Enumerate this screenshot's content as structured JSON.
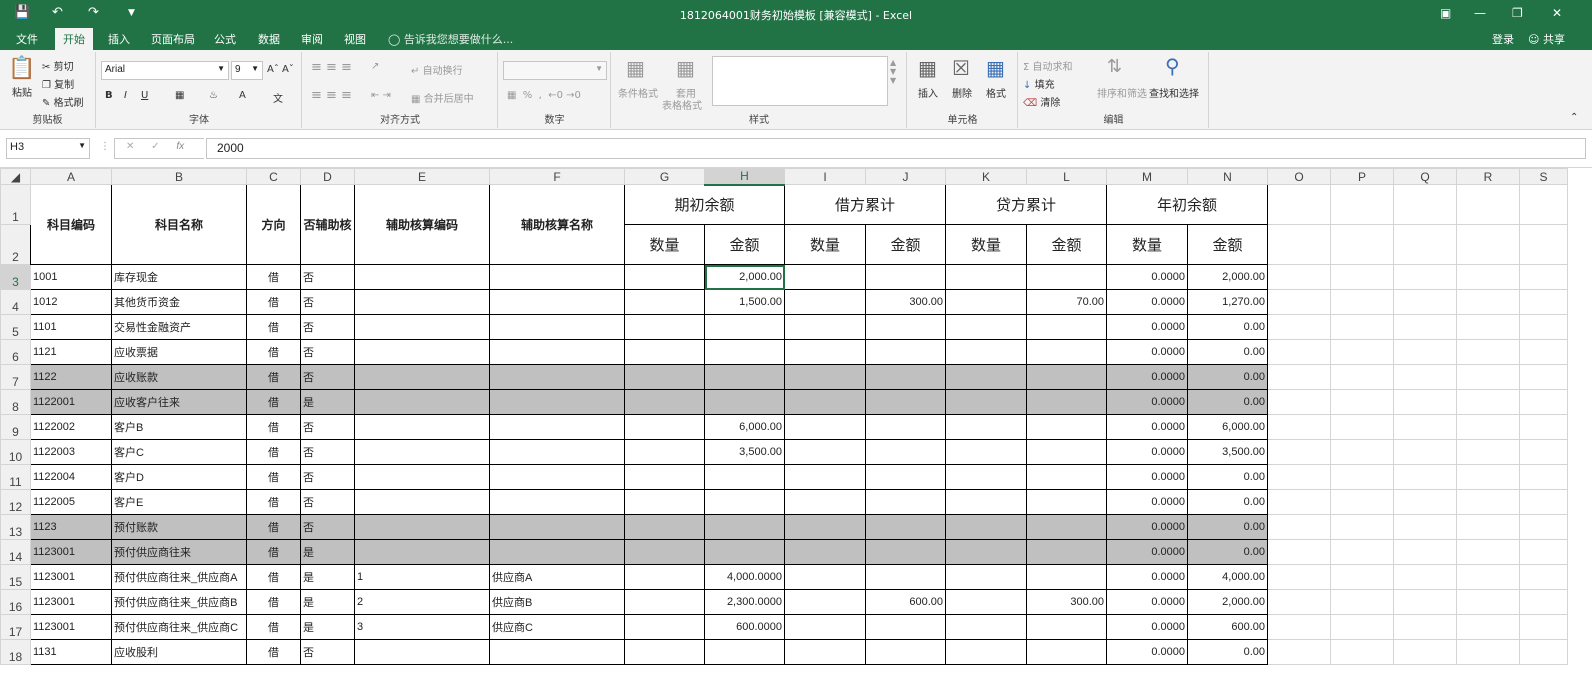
{
  "window": {
    "title": "1812064001财务初始模板  [兼容模式] - Excel",
    "login": "登录",
    "share": "共享"
  },
  "tabs": [
    "文件",
    "开始",
    "插入",
    "页面布局",
    "公式",
    "数据",
    "审阅",
    "视图"
  ],
  "tell_me": "告诉我您想要做什么...",
  "ribbon": {
    "clipboard": {
      "paste": "粘贴",
      "cut": "剪切",
      "copy": "复制",
      "format_painter": "格式刷",
      "label": "剪贴板"
    },
    "font": {
      "name": "Arial",
      "size": "9",
      "label": "字体"
    },
    "alignment": {
      "wrap": "自动换行",
      "merge": "合并后居中",
      "label": "对齐方式"
    },
    "number": {
      "label": "数字"
    },
    "styles": {
      "conditional": "条件格式",
      "table_top": "套用",
      "table_bottom": "表格格式",
      "label": "样式"
    },
    "cells": {
      "insert": "插入",
      "delete": "删除",
      "format": "格式",
      "label": "单元格"
    },
    "editing": {
      "autosum": "自动求和",
      "fill": "填充",
      "clear": "清除",
      "sort": "排序和筛选",
      "find": "查找和选择",
      "label": "编辑"
    }
  },
  "formula_bar": {
    "name_box": "H3",
    "fx": "fx",
    "value": "2000"
  },
  "columns": [
    "A",
    "B",
    "C",
    "D",
    "E",
    "F",
    "G",
    "H",
    "I",
    "J",
    "K",
    "L",
    "M",
    "N",
    "O",
    "P",
    "Q",
    "R",
    "S"
  ],
  "headers": {
    "code": "科目编码",
    "name": "科目名称",
    "dir": "方向",
    "aux": "否辅助核",
    "aux_code": "辅助核算编码",
    "aux_name": "辅助核算名称",
    "opening": "期初余额",
    "debit": "借方累计",
    "credit": "贷方累计",
    "year": "年初余额",
    "qty": "数量",
    "amt": "金额"
  },
  "rows": [
    {
      "num": "3",
      "code": "1001",
      "name": "库存现金",
      "dir": "借",
      "aux": "否",
      "e": "",
      "f": "",
      "g": "",
      "h": "2,000.00",
      "i": "",
      "j": "",
      "k": "",
      "l": "",
      "m": "0.0000",
      "n": "2,000.00",
      "gray": false
    },
    {
      "num": "4",
      "code": "1012",
      "name": "其他货币资金",
      "dir": "借",
      "aux": "否",
      "e": "",
      "f": "",
      "g": "",
      "h": "1,500.00",
      "i": "",
      "j": "300.00",
      "k": "",
      "l": "70.00",
      "m": "0.0000",
      "n": "1,270.00",
      "gray": false
    },
    {
      "num": "5",
      "code": "1101",
      "name": "交易性金融资产",
      "dir": "借",
      "aux": "否",
      "e": "",
      "f": "",
      "g": "",
      "h": "",
      "i": "",
      "j": "",
      "k": "",
      "l": "",
      "m": "0.0000",
      "n": "0.00",
      "gray": false
    },
    {
      "num": "6",
      "code": "1121",
      "name": "应收票据",
      "dir": "借",
      "aux": "否",
      "e": "",
      "f": "",
      "g": "",
      "h": "",
      "i": "",
      "j": "",
      "k": "",
      "l": "",
      "m": "0.0000",
      "n": "0.00",
      "gray": false
    },
    {
      "num": "7",
      "code": "1122",
      "name": "应收账款",
      "dir": "借",
      "aux": "否",
      "e": "",
      "f": "",
      "g": "",
      "h": "",
      "i": "",
      "j": "",
      "k": "",
      "l": "",
      "m": "0.0000",
      "n": "0.00",
      "gray": true
    },
    {
      "num": "8",
      "code": "1122001",
      "name": "应收客户往来",
      "dir": "借",
      "aux": "是",
      "e": "",
      "f": "",
      "g": "",
      "h": "",
      "i": "",
      "j": "",
      "k": "",
      "l": "",
      "m": "0.0000",
      "n": "0.00",
      "gray": true
    },
    {
      "num": "9",
      "code": "1122002",
      "name": "客户B",
      "dir": "借",
      "aux": "否",
      "e": "",
      "f": "",
      "g": "",
      "h": "6,000.00",
      "i": "",
      "j": "",
      "k": "",
      "l": "",
      "m": "0.0000",
      "n": "6,000.00",
      "gray": false
    },
    {
      "num": "10",
      "code": "1122003",
      "name": "客户C",
      "dir": "借",
      "aux": "否",
      "e": "",
      "f": "",
      "g": "",
      "h": "3,500.00",
      "i": "",
      "j": "",
      "k": "",
      "l": "",
      "m": "0.0000",
      "n": "3,500.00",
      "gray": false
    },
    {
      "num": "11",
      "code": "1122004",
      "name": "客户D",
      "dir": "借",
      "aux": "否",
      "e": "",
      "f": "",
      "g": "",
      "h": "",
      "i": "",
      "j": "",
      "k": "",
      "l": "",
      "m": "0.0000",
      "n": "0.00",
      "gray": false
    },
    {
      "num": "12",
      "code": "1122005",
      "name": "客户E",
      "dir": "借",
      "aux": "否",
      "e": "",
      "f": "",
      "g": "",
      "h": "",
      "i": "",
      "j": "",
      "k": "",
      "l": "",
      "m": "0.0000",
      "n": "0.00",
      "gray": false
    },
    {
      "num": "13",
      "code": "1123",
      "name": "预付账款",
      "dir": "借",
      "aux": "否",
      "e": "",
      "f": "",
      "g": "",
      "h": "",
      "i": "",
      "j": "",
      "k": "",
      "l": "",
      "m": "0.0000",
      "n": "0.00",
      "gray": true
    },
    {
      "num": "14",
      "code": "1123001",
      "name": "预付供应商往来",
      "dir": "借",
      "aux": "是",
      "e": "",
      "f": "",
      "g": "",
      "h": "",
      "i": "",
      "j": "",
      "k": "",
      "l": "",
      "m": "0.0000",
      "n": "0.00",
      "gray": true
    },
    {
      "num": "15",
      "code": "1123001",
      "name": "预付供应商往来_供应商A",
      "dir": "借",
      "aux": "是",
      "e": "1",
      "f": "供应商A",
      "g": "",
      "h": "4,000.0000",
      "i": "",
      "j": "",
      "k": "",
      "l": "",
      "m": "0.0000",
      "n": "4,000.00",
      "gray": false
    },
    {
      "num": "16",
      "code": "1123001",
      "name": "预付供应商往来_供应商B",
      "dir": "借",
      "aux": "是",
      "e": "2",
      "f": "供应商B",
      "g": "",
      "h": "2,300.0000",
      "i": "",
      "j": "600.00",
      "k": "",
      "l": "300.00",
      "m": "0.0000",
      "n": "2,000.00",
      "gray": false
    },
    {
      "num": "17",
      "code": "1123001",
      "name": "预付供应商往来_供应商C",
      "dir": "借",
      "aux": "是",
      "e": "3",
      "f": "供应商C",
      "g": "",
      "h": "600.0000",
      "i": "",
      "j": "",
      "k": "",
      "l": "",
      "m": "0.0000",
      "n": "600.00",
      "gray": false
    },
    {
      "num": "18",
      "code": "1131",
      "name": "应收股利",
      "dir": "借",
      "aux": "否",
      "e": "",
      "f": "",
      "g": "",
      "h": "",
      "i": "",
      "j": "",
      "k": "",
      "l": "",
      "m": "0.0000",
      "n": "0.00",
      "gray": false
    }
  ],
  "colors": {
    "excel_green": "#217346",
    "band_gray": "#c0c0c0"
  }
}
